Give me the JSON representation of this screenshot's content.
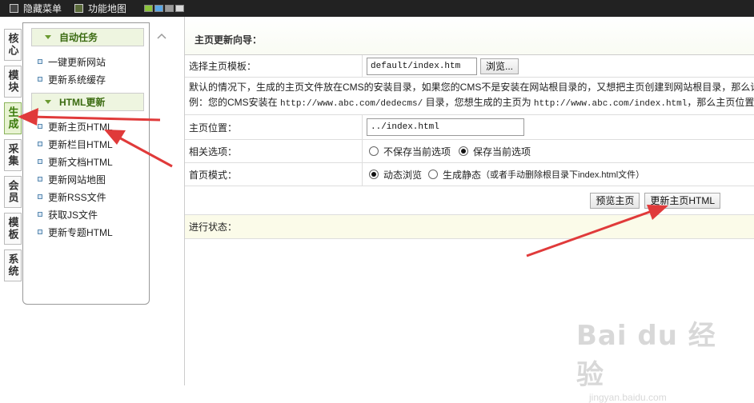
{
  "topbar": {
    "hide_menu": "隐藏菜单",
    "feature_map": "功能地图",
    "swatch_colors": [
      "#8cc43c",
      "#5aa7e6",
      "#9a9a9a",
      "#d8d8d8"
    ]
  },
  "left_tabs": [
    {
      "label": "核心",
      "active": false
    },
    {
      "label": "模块",
      "active": false
    },
    {
      "label": "生成",
      "active": true
    },
    {
      "label": "采集",
      "active": false
    },
    {
      "label": "会员",
      "active": false
    },
    {
      "label": "模板",
      "active": false
    },
    {
      "label": "系统",
      "active": false
    }
  ],
  "menu": {
    "section1": {
      "title": "自动任务",
      "items": [
        "一键更新网站",
        "更新系统缓存"
      ]
    },
    "section2": {
      "title": "HTML更新",
      "items": [
        "更新主页HTML",
        "更新栏目HTML",
        "更新文档HTML",
        "更新网站地图",
        "更新RSS文件",
        "获取JS文件",
        "更新专题HTML"
      ]
    }
  },
  "content": {
    "title": "主页更新向导：",
    "template_label": "选择主页模板：",
    "template_value": "default/index.htm",
    "browse_button": "浏览...",
    "note_line1": "默认的情况下，生成的主页文件放在CMS的安装目录，如果您的CMS不是安装在网站根目录的，又想把主页创建到网站根目录，那么请用",
    "note_line2_a": "例：您的CMS安装在 ",
    "note_line2_url1": "http://www.abc.com/dedecms/",
    "note_line2_b": " 目录，您想生成的主页为 ",
    "note_line2_url2": "http://www.abc.com/index.html",
    "note_line2_c": "，那么主页位置就应该",
    "position_label": "主页位置：",
    "position_value": "../index.html",
    "options_label": "相关选项：",
    "option_nosave": "不保存当前选项",
    "option_save": "保存当前选项",
    "mode_label": "首页模式：",
    "mode_dynamic": "动态浏览",
    "mode_static": "生成静态",
    "mode_static_hint": "（或者手动删除根目录下index.html文件）",
    "preview_button": "预览主页",
    "update_button": "更新主页HTML",
    "status_label": "进行状态："
  },
  "watermark": {
    "brand": "Bai du 经验",
    "url": "jingyan.baidu.com"
  },
  "accent_color": "#e03a3a"
}
